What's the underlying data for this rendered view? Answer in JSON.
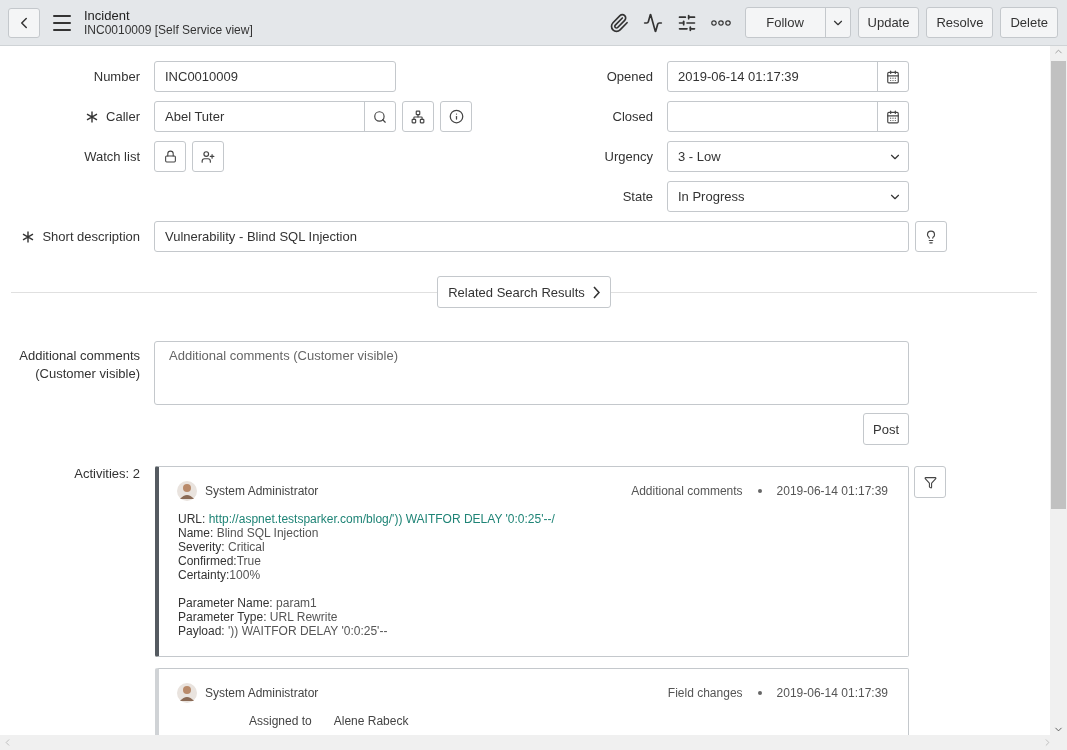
{
  "header": {
    "title": "Incident",
    "subtitle": "INC0010009 [Self Service view]",
    "buttons": [
      {
        "label": "Follow",
        "kind": "split"
      },
      {
        "label": "Update",
        "kind": "plain"
      },
      {
        "label": "Resolve",
        "kind": "plain"
      },
      {
        "label": "Delete",
        "kind": "plain"
      }
    ]
  },
  "form": {
    "left": [
      {
        "label": "Number",
        "required": false,
        "kind": "text",
        "value": "INC0010009"
      },
      {
        "label": "Caller",
        "required": true,
        "kind": "reference",
        "value": "Abel Tuter"
      },
      {
        "label": "Watch list",
        "required": false,
        "kind": "watchlist"
      }
    ],
    "right": [
      {
        "label": "Opened",
        "kind": "datetime",
        "value": "2019-06-14 01:17:39"
      },
      {
        "label": "Closed",
        "kind": "datetime"
      },
      {
        "label": "Urgency",
        "kind": "select",
        "value": "3 - Low"
      },
      {
        "label": "State",
        "kind": "select",
        "value": "In Progress"
      }
    ],
    "short_description": {
      "label": "Short description",
      "required": true,
      "value": "Vulnerability - Blind SQL Injection"
    }
  },
  "related_button": "Related Search Results",
  "comments": {
    "label": "Additional comments (Customer visible)",
    "placeholder": "Additional comments (Customer visible)",
    "post_button": "Post"
  },
  "activities": {
    "label": "Activities: 2",
    "entries": [
      {
        "kind": "comment",
        "author": "System Administrator",
        "type": "Additional comments",
        "time": "2019-06-14 01:17:39",
        "groups": [
          [
            {
              "label": "URL: ",
              "value": "http://aspnet.testsparker.com/blog/')) WAITFOR DELAY '0:0:25'--/",
              "kind": "link"
            },
            {
              "label": "Name: ",
              "value": "Blind SQL Injection",
              "kind": "text"
            },
            {
              "label": "Severity: ",
              "value": "Critical",
              "kind": "text"
            },
            {
              "label": "Confirmed:",
              "value": "True",
              "kind": "text"
            },
            {
              "label": "Certainty:",
              "value": "100%",
              "kind": "text"
            }
          ],
          [
            {
              "label": "Parameter Name: ",
              "value": "param1",
              "kind": "text"
            },
            {
              "label": "Parameter Type: ",
              "value": "URL Rewrite",
              "kind": "text"
            },
            {
              "label": "Payload: ",
              "value": "')) WAITFOR DELAY '0:0:25'--",
              "kind": "text"
            }
          ]
        ]
      },
      {
        "kind": "field_change",
        "author": "System Administrator",
        "type": "Field changes",
        "time": "2019-06-14 01:17:39",
        "changes": [
          {
            "field": "Assigned to",
            "value": "Alene Rabeck"
          }
        ]
      }
    ]
  }
}
